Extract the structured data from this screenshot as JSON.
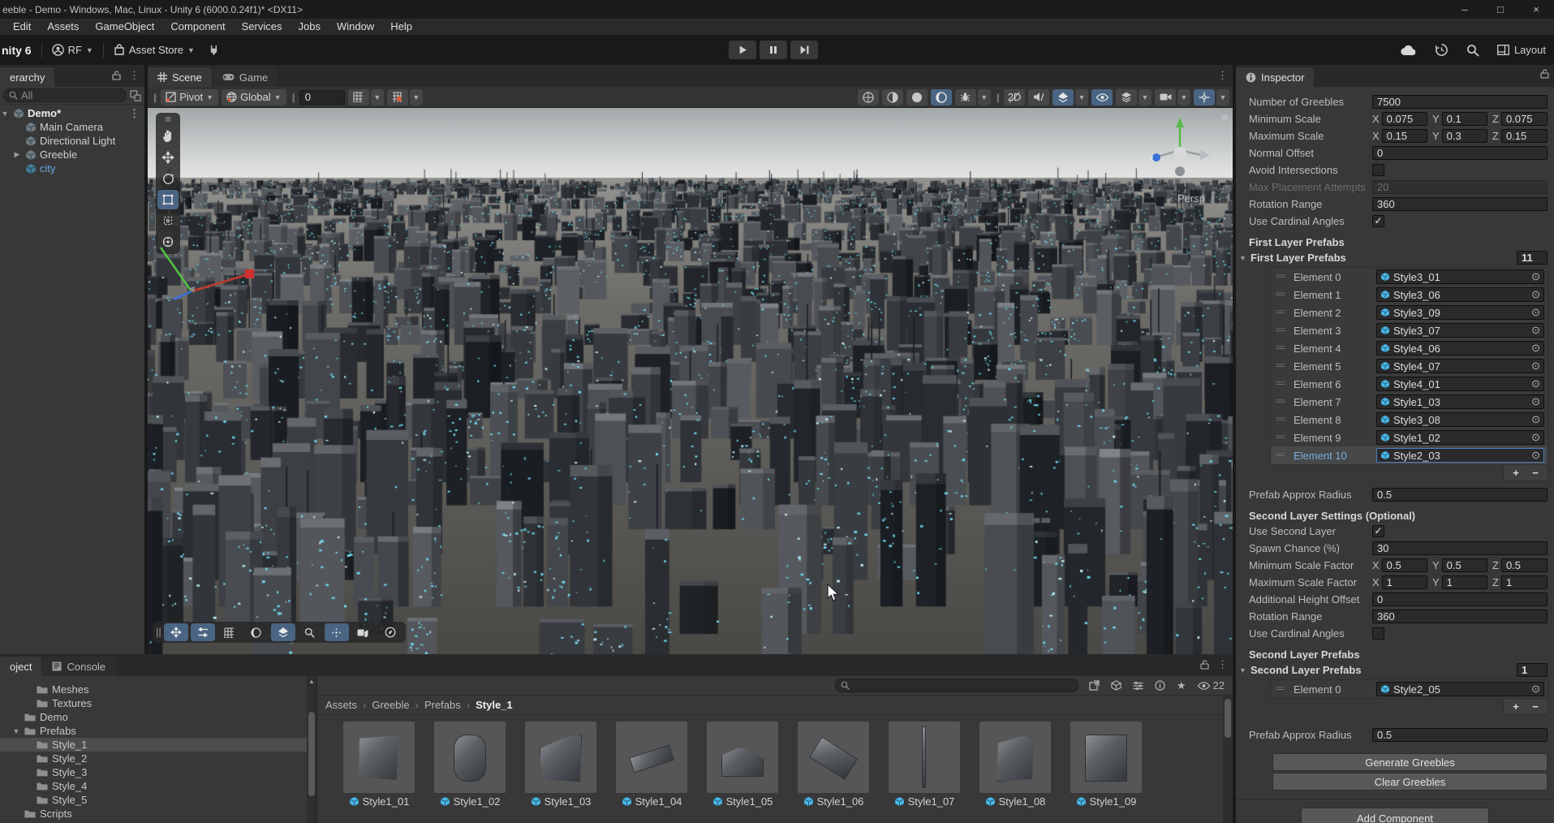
{
  "title_bar": {
    "title": "eeble - Demo - Windows, Mac, Linux - Unity 6 (6000.0.24f1)* <DX11>",
    "minimize": "–",
    "maximize": "□",
    "close": "×"
  },
  "menu_bar": {
    "items": [
      "Edit",
      "Assets",
      "GameObject",
      "Component",
      "Services",
      "Jobs",
      "Window",
      "Help"
    ]
  },
  "toolbar": {
    "version_label": "nity 6",
    "account_label": "RF",
    "asset_store_label": "Asset Store",
    "layout_label": "Layout"
  },
  "hierarchy": {
    "tab_label": "erarchy",
    "search_placeholder": "All",
    "items": [
      {
        "label": "Demo*",
        "bold": true,
        "scene": true,
        "indent": 0,
        "expander": "▼"
      },
      {
        "label": "Main Camera",
        "indent": 1
      },
      {
        "label": "Directional Light",
        "indent": 1
      },
      {
        "label": "Greeble",
        "indent": 1,
        "expander": "▶"
      },
      {
        "label": "city",
        "indent": 1,
        "prefab": true
      }
    ]
  },
  "scene": {
    "tabs": {
      "scene": "Scene",
      "game": "Game"
    },
    "toolbar": {
      "pivot": "Pivot",
      "global": "Global",
      "snap_value": "0",
      "two_d": "2D"
    },
    "persp_label": "Persp"
  },
  "inspector": {
    "tab_label": "Inspector",
    "rows": {
      "number_of_greebles": {
        "label": "Number of Greebles",
        "value": "7500"
      },
      "minimum_scale": {
        "label": "Minimum Scale",
        "x": "0.075",
        "y": "0.1",
        "z": "0.075"
      },
      "maximum_scale": {
        "label": "Maximum Scale",
        "x": "0.15",
        "y": "0.3",
        "z": "0.15"
      },
      "normal_offset": {
        "label": "Normal Offset",
        "value": "0"
      },
      "avoid_intersections": {
        "label": "Avoid Intersections",
        "check": ""
      },
      "max_placement_attempts": {
        "label": "Max Placement Attempts",
        "value": "20"
      },
      "rotation_range": {
        "label": "Rotation Range",
        "value": "360"
      },
      "use_cardinal_angles": {
        "label": "Use Cardinal Angles",
        "check": "✓"
      }
    },
    "first_layer": {
      "section_label": "First Layer Prefabs",
      "foldout_label": "First Layer Prefabs",
      "count": "11",
      "elements": [
        {
          "label": "Element 0",
          "value": "Style3_01"
        },
        {
          "label": "Element 1",
          "value": "Style3_06"
        },
        {
          "label": "Element 2",
          "value": "Style3_09"
        },
        {
          "label": "Element 3",
          "value": "Style3_07"
        },
        {
          "label": "Element 4",
          "value": "Style4_06"
        },
        {
          "label": "Element 5",
          "value": "Style4_07"
        },
        {
          "label": "Element 6",
          "value": "Style4_01"
        },
        {
          "label": "Element 7",
          "value": "Style1_03"
        },
        {
          "label": "Element 8",
          "value": "Style3_08"
        },
        {
          "label": "Element 9",
          "value": "Style1_02"
        },
        {
          "label": "Element 10",
          "value": "Style2_03",
          "selected": true
        }
      ],
      "radius_label": "Prefab Approx Radius",
      "radius_value": "0.5"
    },
    "second_settings": {
      "section_label": "Second Layer Settings (Optional)",
      "use_second_layer": {
        "label": "Use Second Layer",
        "check": "✓"
      },
      "spawn_chance": {
        "label": "Spawn Chance (%)",
        "value": "30"
      },
      "min_scale_factor": {
        "label": "Minimum Scale Factor",
        "x": "0.5",
        "y": "0.5",
        "z": "0.5"
      },
      "max_scale_factor": {
        "label": "Maximum Scale Factor",
        "x": "1",
        "y": "1",
        "z": "1"
      },
      "additional_height_offset": {
        "label": "Additional Height Offset",
        "value": "0"
      },
      "rotation_range": {
        "label": "Rotation Range",
        "value": "360"
      },
      "use_cardinal_angles": {
        "label": "Use Cardinal Angles",
        "check": ""
      }
    },
    "second_layer": {
      "section_label": "Second Layer Prefabs",
      "foldout_label": "Second Layer Prefabs",
      "count": "1",
      "elements": [
        {
          "label": "Element 0",
          "value": "Style2_05"
        }
      ],
      "radius_label": "Prefab Approx Radius",
      "radius_value": "0.5"
    },
    "buttons": {
      "generate": "Generate Greebles",
      "clear": "Clear Greebles",
      "add_component": "Add Component",
      "plus": "+",
      "minus": "−"
    }
  },
  "project": {
    "tab_label": "oject",
    "console_tab_label": "Console",
    "folders": [
      {
        "label": "Meshes",
        "indent": 2
      },
      {
        "label": "Textures",
        "indent": 2
      },
      {
        "label": "Demo",
        "indent": 1
      },
      {
        "label": "Prefabs",
        "indent": 1,
        "open": true,
        "expander": "▼"
      },
      {
        "label": "Style_1",
        "indent": 2,
        "selected": true
      },
      {
        "label": "Style_2",
        "indent": 2
      },
      {
        "label": "Style_3",
        "indent": 2
      },
      {
        "label": "Style_4",
        "indent": 2
      },
      {
        "label": "Style_5",
        "indent": 2
      },
      {
        "label": "Scripts",
        "indent": 1
      }
    ],
    "breadcrumb": [
      {
        "label": "Assets"
      },
      {
        "label": "Greeble"
      },
      {
        "label": "Prefabs"
      },
      {
        "label": "Style_1",
        "current": true
      }
    ],
    "assets": [
      {
        "name": "Style1_01"
      },
      {
        "name": "Style1_02"
      },
      {
        "name": "Style1_03"
      },
      {
        "name": "Style1_04"
      },
      {
        "name": "Style1_05"
      },
      {
        "name": "Style1_06"
      },
      {
        "name": "Style1_07"
      },
      {
        "name": "Style1_08"
      },
      {
        "name": "Style1_09"
      }
    ],
    "visible_count": "22"
  }
}
